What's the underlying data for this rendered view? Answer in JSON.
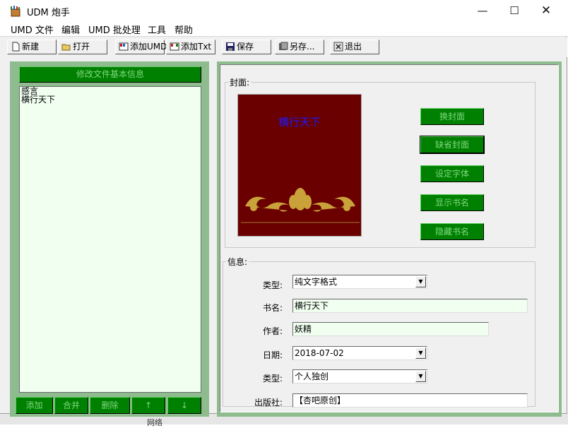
{
  "window": {
    "title": "UDM 炮手",
    "minimize": "—",
    "maximize": "☐",
    "close": "✕"
  },
  "menu": [
    "UMD 文件",
    "编辑",
    "UMD 批处理",
    "工具",
    "帮助"
  ],
  "toolbar": {
    "new": "新建",
    "open": "打开",
    "add_umd": "添加UMD",
    "add_txt": "添加Txt",
    "save": "保存",
    "save_as": "另存...",
    "exit": "退出"
  },
  "left": {
    "edit_info_button": "修改文件基本信息",
    "list_items": [
      "感言",
      "横行天下"
    ],
    "buttons": {
      "add": "添加",
      "merge": "合并",
      "delete": "删除",
      "up": "↑",
      "down": "↓"
    }
  },
  "cover_group": {
    "legend": "封面:",
    "cover_title": "横行天下",
    "buttons": {
      "change": "换封面",
      "default": "缺省封面",
      "font": "设定字体",
      "show_title": "显示书名",
      "hide_title": "隐藏书名"
    }
  },
  "info_group": {
    "legend": "信息:",
    "type_label": "类型:",
    "type_value": "纯文字格式",
    "bookname_label": "书名:",
    "bookname_value": "横行天下",
    "author_label": "作者:",
    "author_value": "妖精",
    "date_label": "日期:",
    "date_value": "2018-07-02",
    "genre_label": "类型:",
    "genre_value": "个人独创",
    "publisher_label": "出版社:",
    "publisher_value": "【杏吧原创】"
  },
  "taskbar_fragment": {
    "network_label": "网络"
  },
  "colors": {
    "panel_green": "#8fbc8f",
    "button_green": "#008000",
    "button_text": "#7fd87f",
    "cover_bg": "#6b0000",
    "cover_title": "#1a1aff",
    "ornament": "#c9a23a"
  }
}
